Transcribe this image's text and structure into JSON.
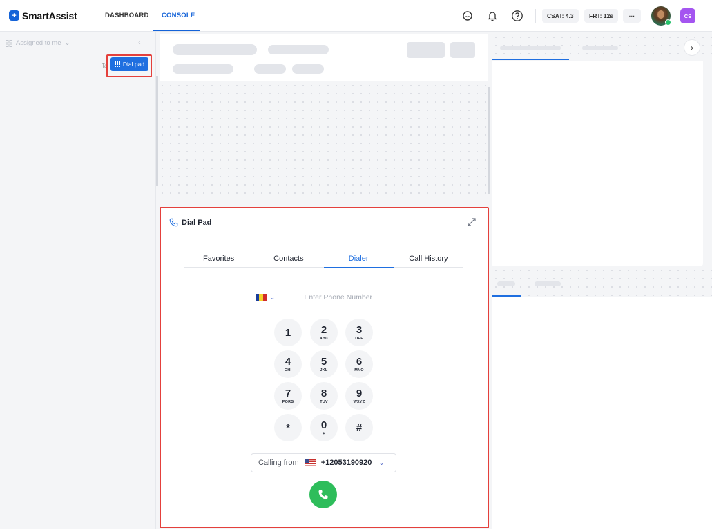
{
  "app": {
    "name": "SmartAssist",
    "logo_mark": "+"
  },
  "nav": {
    "tabs": [
      {
        "label": "DASHBOARD"
      },
      {
        "label": "CONSOLE"
      }
    ],
    "active": "CONSOLE"
  },
  "header": {
    "icons": [
      "chat-icon",
      "bell-icon",
      "help-icon"
    ],
    "csat": "CSAT: 4.3",
    "frt": "FRT: 12s",
    "more": "···",
    "user_initials": "CS"
  },
  "left_panel": {
    "assigned_label": "Assigned to me",
    "ta_label": "Ta",
    "dialpad_button": "Dial pad"
  },
  "dial_pad": {
    "title": "Dial Pad",
    "tabs": [
      "Favorites",
      "Contacts",
      "Dialer",
      "Call History"
    ],
    "active_tab": "Dialer",
    "phone_placeholder": "Enter Phone Number",
    "keys": [
      {
        "digit": "1",
        "letters": ""
      },
      {
        "digit": "2",
        "letters": "ABC"
      },
      {
        "digit": "3",
        "letters": "DEF"
      },
      {
        "digit": "4",
        "letters": "GHI"
      },
      {
        "digit": "5",
        "letters": "JKL"
      },
      {
        "digit": "6",
        "letters": "MNO"
      },
      {
        "digit": "7",
        "letters": "PQRS"
      },
      {
        "digit": "8",
        "letters": "TUV"
      },
      {
        "digit": "9",
        "letters": "WXYZ"
      },
      {
        "digit": "*",
        "letters": ""
      },
      {
        "digit": "0",
        "letters": "+"
      },
      {
        "digit": "#",
        "letters": ""
      }
    ],
    "calling_from_label": "Calling from",
    "calling_from_number": "+12053190920"
  },
  "colors": {
    "accent": "#1f6fe0",
    "highlight": "#e4403c",
    "call": "#2ebd5b",
    "badge": "#a455f0"
  }
}
